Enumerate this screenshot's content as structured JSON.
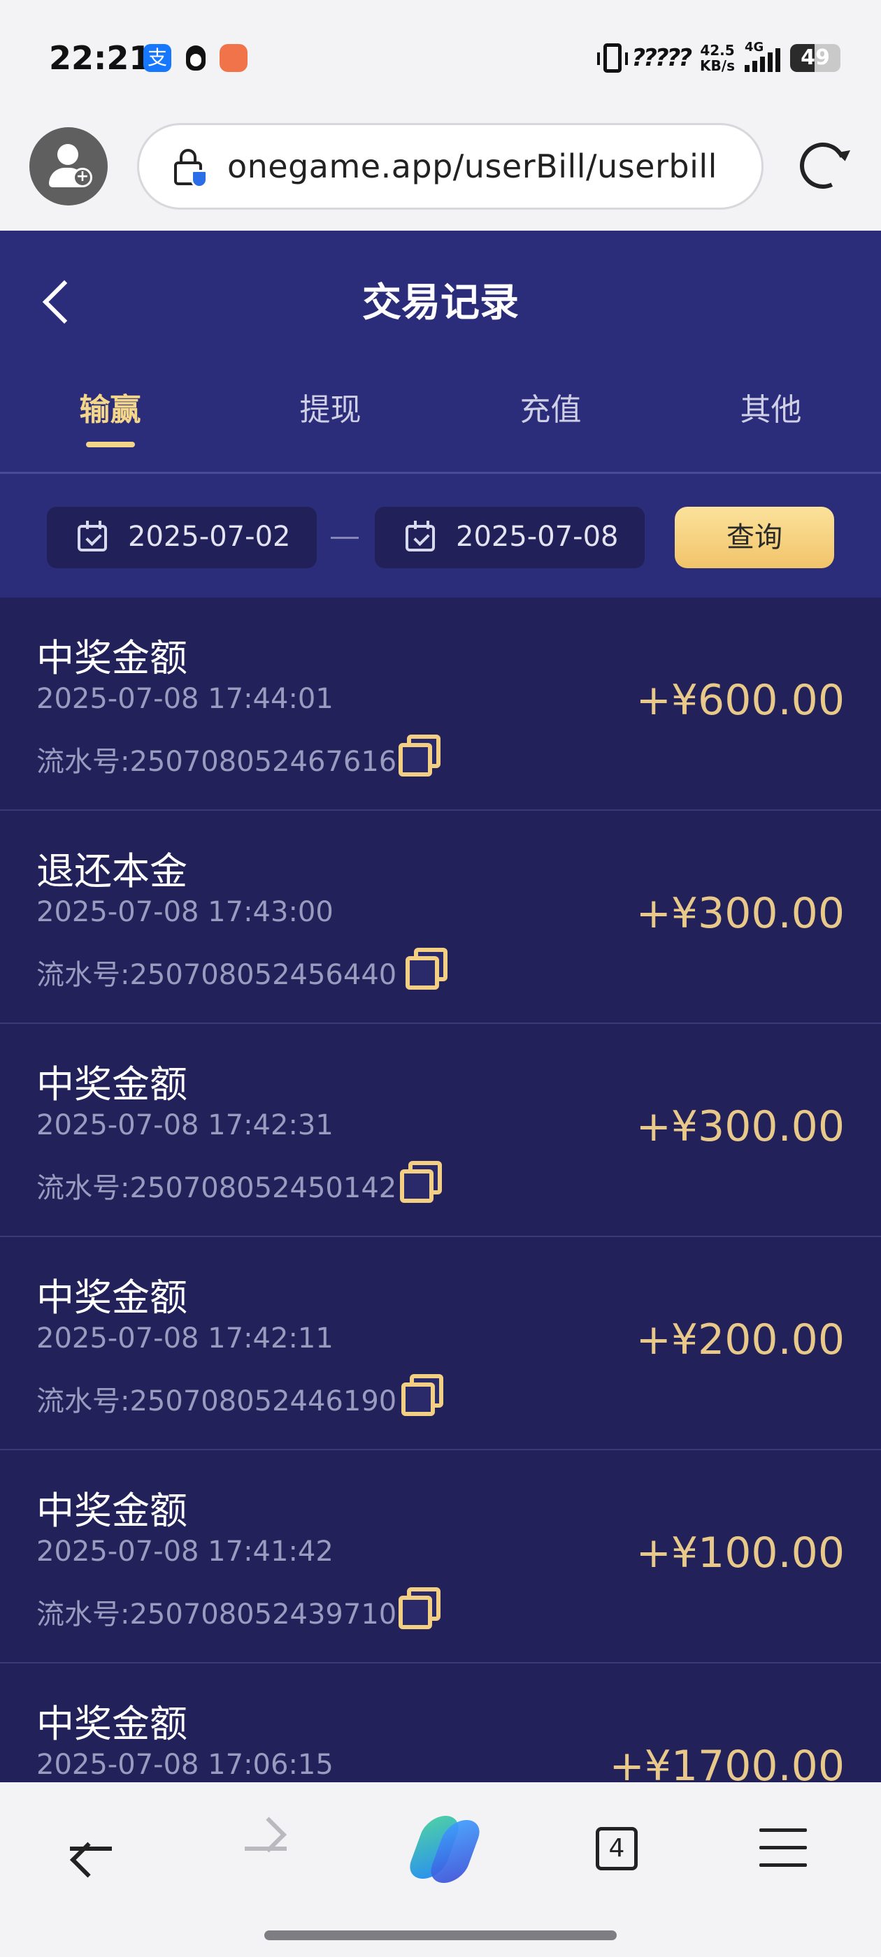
{
  "status_bar": {
    "time": "22:21",
    "alipay_glyph": "支",
    "hd": "?????",
    "net_speed_value": "42.5",
    "net_speed_unit": "KB/s",
    "signal_label": "4G",
    "battery": "49",
    "battery_level": 0.49
  },
  "browser": {
    "url": "onegame.app/userBill/userbill",
    "tabs_count": "4"
  },
  "page": {
    "title": "交易记录",
    "tabs": [
      {
        "label": "输赢",
        "active": true
      },
      {
        "label": "提现",
        "active": false
      },
      {
        "label": "充值",
        "active": false
      },
      {
        "label": "其他",
        "active": false
      }
    ],
    "filter": {
      "start_date": "2025-07-02",
      "end_date": "2025-07-08",
      "query_label": "查询"
    },
    "records": [
      {
        "title": "中奖金额",
        "time": "2025-07-08 17:44:01",
        "serial": "流水号:250708052467616",
        "amount": "+¥600.00"
      },
      {
        "title": "退还本金",
        "time": "2025-07-08 17:43:00",
        "serial": "流水号:250708052456440",
        "amount": "+¥300.00"
      },
      {
        "title": "中奖金额",
        "time": "2025-07-08 17:42:31",
        "serial": "流水号:250708052450142",
        "amount": "+¥300.00"
      },
      {
        "title": "中奖金额",
        "time": "2025-07-08 17:42:11",
        "serial": "流水号:250708052446190",
        "amount": "+¥200.00"
      },
      {
        "title": "中奖金额",
        "time": "2025-07-08 17:41:42",
        "serial": "流水号:250708052439710",
        "amount": "+¥100.00"
      },
      {
        "title": "中奖金额",
        "time": "2025-07-08 17:06:15",
        "serial": "",
        "amount": "+¥1700.00"
      }
    ]
  },
  "colors": {
    "header_bg": "#2b2c7a",
    "list_bg": "#22215a",
    "accent_gold": "#f3d68a",
    "amount_gold": "#e8c98a"
  },
  "icons": {
    "status": [
      "alipay-icon",
      "qq-icon",
      "fox-app-icon",
      "vibrate-icon",
      "signal-icon",
      "battery-icon"
    ],
    "browser": [
      "profile-add-icon",
      "lock-shield-icon",
      "reload-icon"
    ],
    "page": [
      "back-chevron-icon",
      "calendar-icon",
      "copy-icon"
    ],
    "nav": [
      "back-arrow-icon",
      "forward-arrow-icon",
      "copilot-icon",
      "tabs-icon",
      "menu-icon"
    ]
  }
}
